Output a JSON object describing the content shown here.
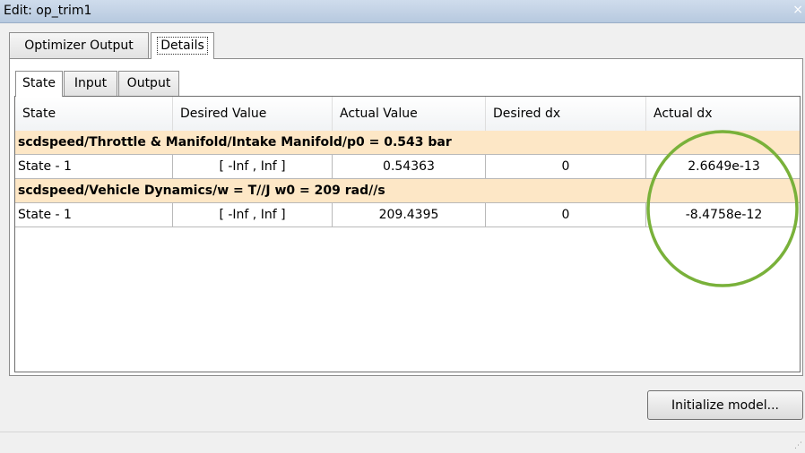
{
  "window": {
    "title": "Edit: op_trim1",
    "close_glyph": "×"
  },
  "outer_tabs": [
    {
      "label": "Optimizer Output",
      "active": false
    },
    {
      "label": "Details",
      "active": true
    }
  ],
  "inner_tabs": [
    {
      "label": "State",
      "active": true
    },
    {
      "label": "Input",
      "active": false
    },
    {
      "label": "Output",
      "active": false
    }
  ],
  "table": {
    "columns": [
      "State",
      "Desired Value",
      "Actual Value",
      "Desired dx",
      "Actual dx"
    ],
    "groups": [
      {
        "title": "scdspeed/Throttle & Manifold/Intake Manifold/p0 = 0.543 bar",
        "rows": [
          [
            "State - 1",
            "[ -Inf , Inf ]",
            "0.54363",
            "0",
            "2.6649e-13"
          ]
        ]
      },
      {
        "title": "scdspeed/Vehicle Dynamics/w = T//J w0 = 209 rad//s",
        "rows": [
          [
            "State - 1",
            "[ -Inf , Inf ]",
            "209.4395",
            "0",
            "-8.4758e-12"
          ]
        ]
      }
    ]
  },
  "buttons": {
    "initialize": "Initialize model..."
  },
  "colors": {
    "group_row_bg": "#fde7c6",
    "highlight_circle": "#79b13a",
    "titlebar": "#c4d4e8"
  }
}
